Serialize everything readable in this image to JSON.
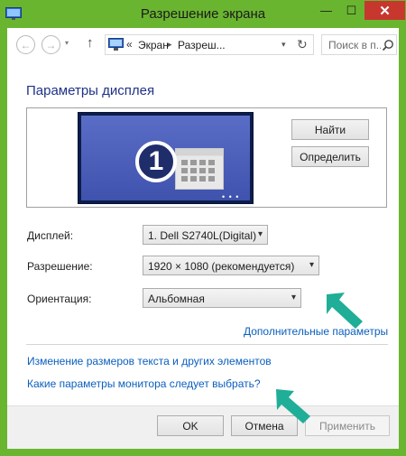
{
  "window": {
    "title": "Разрешение экрана",
    "buttons": {
      "minimize": "—",
      "maximize": "☐",
      "close": "✕"
    }
  },
  "navbar": {
    "back_icon": "←",
    "forward_icon": "→",
    "history_icon": "▾",
    "up_icon": "↑",
    "breadcrumb_sep": "«",
    "breadcrumb": [
      "Экран",
      "Разреш..."
    ],
    "crumb_arrow": "▸",
    "dropdown_icon": "▾",
    "refresh_icon": "↻",
    "search_placeholder": "Поиск в п..."
  },
  "main": {
    "heading": "Параметры дисплея",
    "monitor": {
      "number": "1",
      "dots": "• • •"
    },
    "find_button": "Найти",
    "identify_button": "Определить",
    "display_label": "Дисплей:",
    "display_value": "1. Dell S2740L(Digital)",
    "resolution_label": "Разрешение:",
    "resolution_value": "1920 × 1080 (рекомендуется)",
    "orientation_label": "Ориентация:",
    "orientation_value": "Альбомная",
    "combo_arrow": "▾",
    "advanced_link": "Дополнительные параметры",
    "text_size_link": "Изменение размеров текста и других элементов",
    "monitor_help_link": "Какие параметры монитора следует выбрать?"
  },
  "footer": {
    "ok": "OK",
    "cancel": "Отмена",
    "apply": "Применить"
  },
  "colors": {
    "window_frame": "#6ab530",
    "close_button": "#c7372e",
    "link": "#0a5fbe",
    "heading": "#1e3287",
    "annotation_arrow": "#1fae98"
  },
  "icons": {
    "annotation": "teal-arrow-icon"
  }
}
